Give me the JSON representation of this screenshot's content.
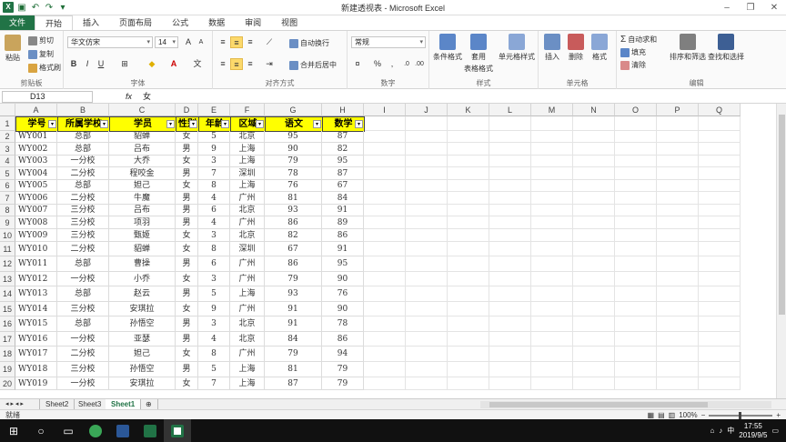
{
  "window": {
    "title": "新建透视表 - Microsoft Excel",
    "qat": [
      "save-icon",
      "undo-icon",
      "redo-icon",
      "customize-icon"
    ]
  },
  "tabs": [
    "文件",
    "开始",
    "插入",
    "页面布局",
    "公式",
    "数据",
    "审阅",
    "视图"
  ],
  "ribbon": {
    "clipboard": {
      "paste": "粘贴",
      "cut": "剪切",
      "copy": "复制",
      "painter": "格式刷",
      "label": "剪贴板"
    },
    "font": {
      "name": "华文仿宋",
      "size": "14",
      "bold": "B",
      "italic": "I",
      "underline": "U",
      "label": "字体"
    },
    "alignment": {
      "wrap": "自动换行",
      "merge": "合并后居中",
      "label": "对齐方式"
    },
    "number": {
      "format": "常规",
      "percent": "%",
      "comma": ",",
      "label": "数字"
    },
    "styles": {
      "conditional": "条件格式",
      "table1": "套用",
      "table2": "表格格式",
      "cell": "单元格样式",
      "label": "样式"
    },
    "cells": {
      "insert": "插入",
      "delete": "删除",
      "format": "格式",
      "label": "单元格"
    },
    "editing": {
      "autosum": "自动求和",
      "fill": "填充",
      "clear": "清除",
      "sort": "排序和筛选",
      "find": "查找和选择",
      "label": "编辑"
    }
  },
  "formula_bar": {
    "name_box": "D13",
    "fx": "fx",
    "value": "女"
  },
  "columns": [
    "A",
    "B",
    "C",
    "D",
    "E",
    "F",
    "G",
    "H",
    "I",
    "J",
    "K",
    "L",
    "M",
    "N",
    "O",
    "P",
    "Q"
  ],
  "table": {
    "headers": [
      "学号",
      "所属学校",
      "学员",
      "性别",
      "年龄",
      "区域",
      "语文",
      "数学"
    ],
    "rows": [
      [
        "WY001",
        "总部",
        "貂蝉",
        "女",
        "5",
        "北京",
        "95",
        "87"
      ],
      [
        "WY002",
        "总部",
        "吕布",
        "男",
        "9",
        "上海",
        "90",
        "82"
      ],
      [
        "WY003",
        "一分校",
        "大乔",
        "女",
        "3",
        "上海",
        "79",
        "95"
      ],
      [
        "WY004",
        "二分校",
        "程咬金",
        "男",
        "7",
        "深圳",
        "78",
        "87"
      ],
      [
        "WY005",
        "总部",
        "妲己",
        "女",
        "8",
        "上海",
        "76",
        "67"
      ],
      [
        "WY006",
        "二分校",
        "牛魔",
        "男",
        "4",
        "广州",
        "81",
        "84"
      ],
      [
        "WY007",
        "三分校",
        "吕布",
        "男",
        "6",
        "北京",
        "93",
        "91"
      ],
      [
        "WY008",
        "三分校",
        "项羽",
        "男",
        "4",
        "广州",
        "86",
        "89"
      ],
      [
        "WY009",
        "三分校",
        "甄姬",
        "女",
        "3",
        "北京",
        "82",
        "86"
      ],
      [
        "WY010",
        "二分校",
        "貂蝉",
        "女",
        "8",
        "深圳",
        "67",
        "91"
      ],
      [
        "WY011",
        "总部",
        "曹操",
        "男",
        "6",
        "广州",
        "86",
        "95"
      ],
      [
        "WY012",
        "一分校",
        "小乔",
        "女",
        "3",
        "广州",
        "79",
        "90"
      ],
      [
        "WY013",
        "总部",
        "赵云",
        "男",
        "5",
        "上海",
        "93",
        "76"
      ],
      [
        "WY014",
        "三分校",
        "安琪拉",
        "女",
        "9",
        "广州",
        "91",
        "90"
      ],
      [
        "WY015",
        "总部",
        "孙悟空",
        "男",
        "3",
        "北京",
        "91",
        "78"
      ],
      [
        "WY016",
        "一分校",
        "亚瑟",
        "男",
        "4",
        "北京",
        "84",
        "86"
      ],
      [
        "WY017",
        "二分校",
        "妲己",
        "女",
        "8",
        "广州",
        "79",
        "94"
      ],
      [
        "WY018",
        "三分校",
        "孙悟空",
        "男",
        "5",
        "上海",
        "81",
        "79"
      ],
      [
        "WY019",
        "一分校",
        "安琪拉",
        "女",
        "7",
        "上海",
        "87",
        "79"
      ]
    ],
    "row_numbers": [
      "1",
      "2",
      "3",
      "4",
      "5",
      "6",
      "7",
      "8",
      "9",
      "10",
      "11",
      "12",
      "13",
      "14",
      "15",
      "16",
      "17",
      "18",
      "19",
      "20"
    ]
  },
  "sheets": [
    "Sheet2",
    "Sheet3",
    "Sheet1"
  ],
  "active_sheet": "Sheet1",
  "status": {
    "ready": "就绪",
    "zoom": "100%",
    "zoom_minus": "−",
    "zoom_plus": "+"
  },
  "taskbar": {
    "time": "17:55",
    "date": "2019/9/5",
    "ime": "中"
  }
}
